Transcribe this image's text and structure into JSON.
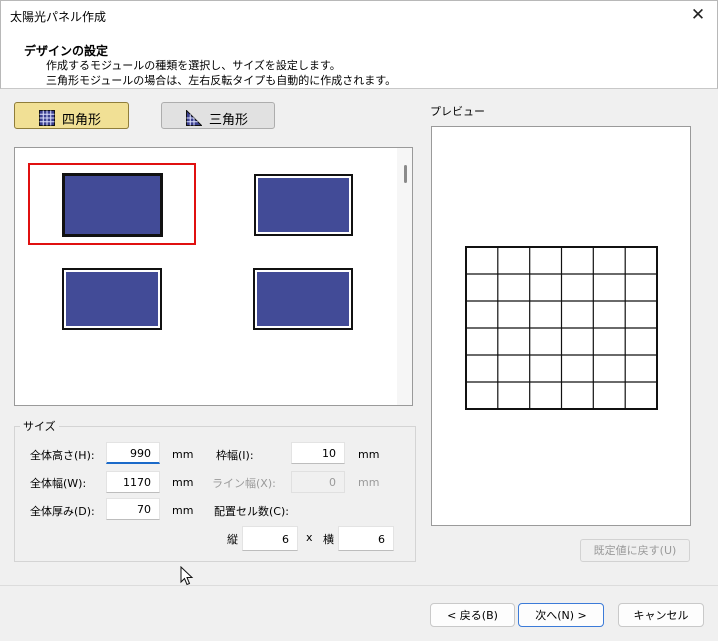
{
  "window": {
    "title": "太陽光パネル作成",
    "close_glyph": "✕"
  },
  "header": {
    "title": "デザインの設定",
    "desc1": "作成するモジュールの種類を選択し、サイズを設定します。",
    "desc2": "三角形モジュールの場合は、左右反転タイプも自動的に作成されます。"
  },
  "type_buttons": {
    "square": "四角形",
    "triangle": "三角形",
    "selected": "square"
  },
  "modules": {
    "count": 4,
    "selected_index": 0,
    "fill_color": "#424b97"
  },
  "size": {
    "group_label": "サイズ",
    "total_height_label": "全体高さ(H):",
    "total_height": "990",
    "total_width_label": "全体幅(W):",
    "total_width": "1170",
    "total_depth_label": "全体厚み(D):",
    "total_depth": "70",
    "frame_width_label": "枠幅(I):",
    "frame_width": "10",
    "line_width_label": "ライン幅(X):",
    "line_width": "0",
    "cell_layout_label": "配置セル数(C):",
    "vertical_label": "縦",
    "vertical": "6",
    "cross": "x",
    "horizontal_label": "横",
    "horizontal": "6",
    "unit": "mm"
  },
  "preview": {
    "label": "プレビュー",
    "rows": 6,
    "cols": 6,
    "reset_button": "既定値に戻す(U)"
  },
  "footer": {
    "back": "< 戻る(B)",
    "next": "次へ(N) >",
    "cancel": "キャンセル"
  }
}
